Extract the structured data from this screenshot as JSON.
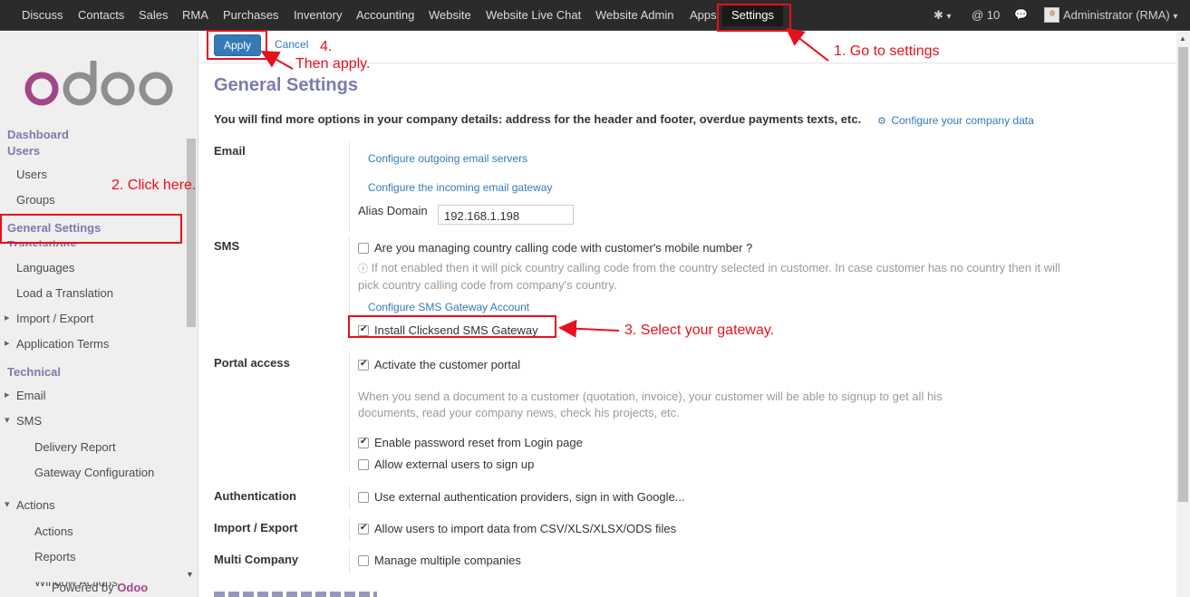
{
  "topnav": {
    "items": [
      "Discuss",
      "Contacts",
      "Sales",
      "RMA",
      "Purchases",
      "Inventory",
      "Accounting",
      "Website",
      "Website Live Chat",
      "Website Admin",
      "Apps",
      "Settings"
    ],
    "active": "Settings",
    "bug_menu": "▾",
    "notifications": "@ 10",
    "chat_icon": "chat-icon",
    "user": "Administrator (RMA)",
    "user_caret": "▾"
  },
  "sidebar": {
    "logo_text": "odoo",
    "sections": [
      {
        "label": "Dashboard"
      },
      {
        "label": "Users"
      },
      {
        "label": "Users"
      },
      {
        "label": "Groups"
      },
      {
        "label": "General Settings"
      },
      {
        "label": "Translations"
      },
      {
        "label": "Languages"
      },
      {
        "label": "Load a Translation"
      },
      {
        "label": "Import / Export"
      },
      {
        "label": "Application Terms"
      },
      {
        "label": "Technical"
      },
      {
        "label": "Email"
      },
      {
        "label": "SMS"
      },
      {
        "label": "Delivery Report"
      },
      {
        "label": "Gateway Configuration"
      },
      {
        "label": "Actions"
      },
      {
        "label": "Actions"
      },
      {
        "label": "Reports"
      },
      {
        "label": "Window Actions"
      }
    ],
    "powered_prefix": "Powered by",
    "powered_brand": "Odoo"
  },
  "toolbar": {
    "apply": "Apply",
    "cancel": "Cancel"
  },
  "page": {
    "title": "General Settings",
    "intro": "You will find more options in your company details: address for the header and footer, overdue payments texts, etc.",
    "configure_company": "Configure your company data"
  },
  "email": {
    "label": "Email",
    "outgoing": "Configure outgoing email servers",
    "incoming": "Configure the incoming email gateway",
    "alias_label": "Alias Domain",
    "alias_value": "192.168.1.198"
  },
  "sms": {
    "label": "SMS",
    "calling_code": "Are you managing country calling code with customer's mobile number ?",
    "help_line1": "If not enabled then it will pick country calling code from the country selected in customer. In case customer has no country then it will",
    "help_line2": "pick country calling code from company's country.",
    "gateway_account": "Configure SMS Gateway Account",
    "clicksend": "Install Clicksend SMS Gateway"
  },
  "portal": {
    "label": "Portal access",
    "activate": "Activate the customer portal",
    "help_line1": "When you send a document to a customer (quotation, invoice), your customer will be able to signup to get all his",
    "help_line2": "documents, read your company news, check his projects, etc.",
    "password_reset": "Enable password reset from Login page",
    "external_signup": "Allow external users to sign up"
  },
  "auth": {
    "label": "Authentication",
    "option": "Use external authentication providers, sign in with Google..."
  },
  "import_export": {
    "label": "Import / Export",
    "option": "Allow users to import data from CSV/XLS/XLSX/ODS files"
  },
  "multi_company": {
    "label": "Multi Company",
    "option": "Manage multiple companies"
  },
  "annotations": {
    "step1": "1. Go to settings",
    "step2": "2. Click here.",
    "step3": "3. Select your gateway.",
    "step4": "4.",
    "step4b": "Then apply."
  },
  "colors": {
    "accent": "#7c7bad",
    "link": "#337ab7",
    "annotation": "#e8101d",
    "topbar": "#2b2b2b"
  }
}
